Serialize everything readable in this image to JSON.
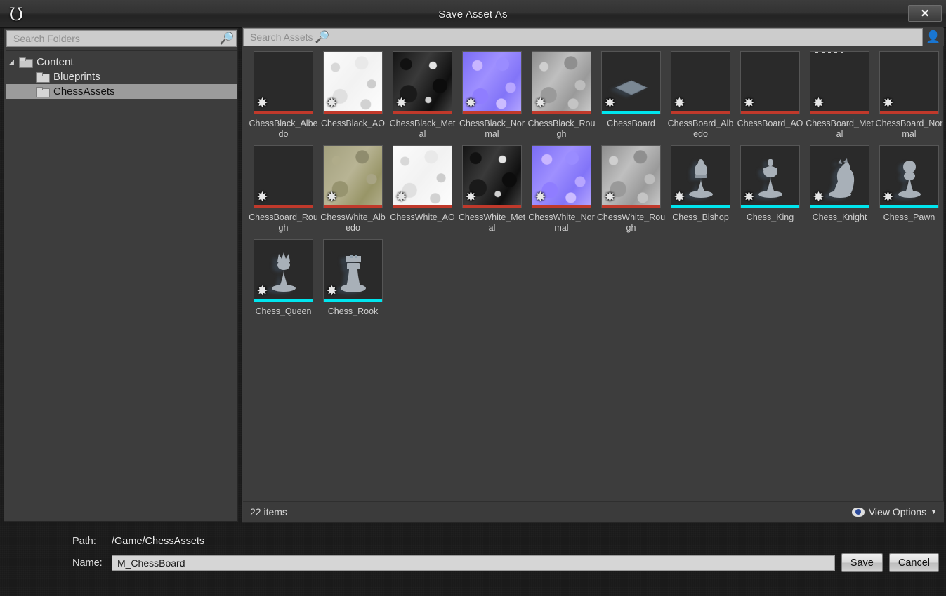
{
  "window": {
    "title": "Save Asset As",
    "logo_glyph": "Ʊ",
    "close_label": "✕"
  },
  "folder_search": {
    "placeholder": "Search Folders",
    "icon": "search-icon"
  },
  "folder_tree": [
    {
      "label": "Content",
      "level": 0,
      "selected": false,
      "expanded": true
    },
    {
      "label": "Blueprints",
      "level": 1,
      "selected": false,
      "expanded": false
    },
    {
      "label": "ChessAssets",
      "level": 1,
      "selected": true,
      "expanded": false
    }
  ],
  "asset_search": {
    "placeholder": "Search Assets",
    "icon": "search-icon",
    "user_icon": "user-icon"
  },
  "assets": [
    {
      "label": "ChessBlack_Albedo",
      "thumb": "tx-swirl-dark",
      "strip": "#c0392b",
      "badge": "✸"
    },
    {
      "label": "ChessBlack_AO",
      "thumb": "tx-swirl-white",
      "strip": "#c0392b",
      "badge": "✸"
    },
    {
      "label": "ChessBlack_Metal",
      "thumb": "tx-swirl-blackmetal",
      "strip": "#c0392b",
      "badge": "✸"
    },
    {
      "label": "ChessBlack_Normal",
      "thumb": "tx-swirl-normal",
      "strip": "#c0392b",
      "badge": "✸"
    },
    {
      "label": "ChessBlack_Rough",
      "thumb": "tx-swirl-gray",
      "strip": "#c0392b",
      "badge": "✸"
    },
    {
      "label": "ChessBoard",
      "thumb": "tx-viewport",
      "strip": "#00e5ee",
      "badge": "✸",
      "piece": "board"
    },
    {
      "label": "ChessBoard_Albedo",
      "thumb": "tx-board-albedo",
      "strip": "#c0392b",
      "badge": "✸"
    },
    {
      "label": "ChessBoard_AO",
      "thumb": "tx-board-ao",
      "strip": "#c0392b",
      "badge": "✸"
    },
    {
      "label": "ChessBoard_Metal",
      "thumb": "tx-board-metal",
      "strip": "#c0392b",
      "badge": "✸"
    },
    {
      "label": "ChessBoard_Normal",
      "thumb": "tx-board-normal",
      "strip": "#c0392b",
      "badge": "✸"
    },
    {
      "label": "ChessBoard_Rough",
      "thumb": "tx-board-rough",
      "strip": "#c0392b",
      "badge": "✸"
    },
    {
      "label": "ChessWhite_Albedo",
      "thumb": "tx-swirl-tan",
      "strip": "#c0392b",
      "badge": "✸"
    },
    {
      "label": "ChessWhite_AO",
      "thumb": "tx-swirl-white",
      "strip": "#c0392b",
      "badge": "✸"
    },
    {
      "label": "ChessWhite_Metal",
      "thumb": "tx-swirl-blackmetal",
      "strip": "#c0392b",
      "badge": "✸"
    },
    {
      "label": "ChessWhite_Normal",
      "thumb": "tx-swirl-normal",
      "strip": "#c0392b",
      "badge": "✸"
    },
    {
      "label": "ChessWhite_Rough",
      "thumb": "tx-swirl-gray",
      "strip": "#c0392b",
      "badge": "✸"
    },
    {
      "label": "Chess_Bishop",
      "thumb": "tx-viewport",
      "strip": "#00e5ee",
      "badge": "✸",
      "piece": "bishop"
    },
    {
      "label": "Chess_King",
      "thumb": "tx-viewport",
      "strip": "#00e5ee",
      "badge": "✸",
      "piece": "king"
    },
    {
      "label": "Chess_Knight",
      "thumb": "tx-viewport",
      "strip": "#00e5ee",
      "badge": "✸",
      "piece": "knight"
    },
    {
      "label": "Chess_Pawn",
      "thumb": "tx-viewport",
      "strip": "#00e5ee",
      "badge": "✸",
      "piece": "pawn"
    },
    {
      "label": "Chess_Queen",
      "thumb": "tx-viewport",
      "strip": "#00e5ee",
      "badge": "✸",
      "piece": "queen"
    },
    {
      "label": "Chess_Rook",
      "thumb": "tx-viewport",
      "strip": "#00e5ee",
      "badge": "✸",
      "piece": "rook"
    }
  ],
  "grid_footer": {
    "items_count": "22 items",
    "view_options_label": "View Options",
    "caret": "▼"
  },
  "form": {
    "path_label": "Path:",
    "path_value": "/Game/ChessAssets",
    "name_label": "Name:",
    "name_value": "M_ChessBoard",
    "save_label": "Save",
    "cancel_label": "Cancel"
  },
  "colors": {
    "panel_bg": "#3d3d3d",
    "selection": "#9b9b9b",
    "texture_strip": "#c0392b",
    "mesh_strip": "#00e5ee"
  }
}
